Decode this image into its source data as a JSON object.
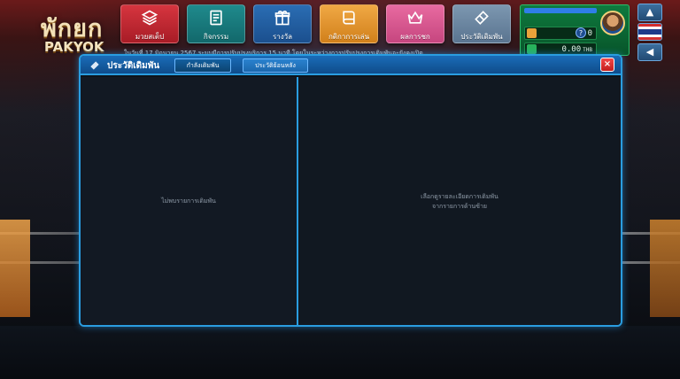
{
  "brand": {
    "logo_top": "พักยก",
    "logo_sub": "PAKYOK"
  },
  "nav": {
    "items": [
      {
        "label": "มวยสเต็ป",
        "icon": "layers-icon"
      },
      {
        "label": "กิจกรรม",
        "icon": "document-icon"
      },
      {
        "label": "รางวัล",
        "icon": "gift-icon"
      },
      {
        "label": "กติกาการเล่น",
        "icon": "book-icon"
      },
      {
        "label": "ผลการชก",
        "icon": "crown-icon"
      },
      {
        "label": "ประวัติเดิมพัน",
        "icon": "ticket-icon"
      }
    ]
  },
  "user": {
    "coins": "0",
    "balance": "0.00",
    "currency": "THB",
    "help": "?"
  },
  "side": {
    "menu_icon": "bell-icon",
    "flag": "thai-flag-icon",
    "sound_icon": "speaker-icon"
  },
  "marquee": "ในวันที่ 17 มิถุนายน 2567 ระบบมีการปรับปรุงบริการ 15 นาที โดยในระหว่างการปรับปรุงการเดิมพันจะยังคงเปิด",
  "modal": {
    "title": "ประวัติเดิมพัน",
    "tab_active": "กำลังเดิมพัน",
    "tab_other": "ประวัติย้อนหลัง",
    "close": "×",
    "empty_left": "ไม่พบรายการเดิมพัน",
    "empty_right_line1": "เลือกดูรายละเอียดการเดิมพัน",
    "empty_right_line2": "จากรายการด้านซ้าย"
  },
  "colors": {
    "accent": "#2a9de0",
    "header": "#1a6cb8",
    "close": "#e23434",
    "user_panel": "#0e7a3e"
  }
}
